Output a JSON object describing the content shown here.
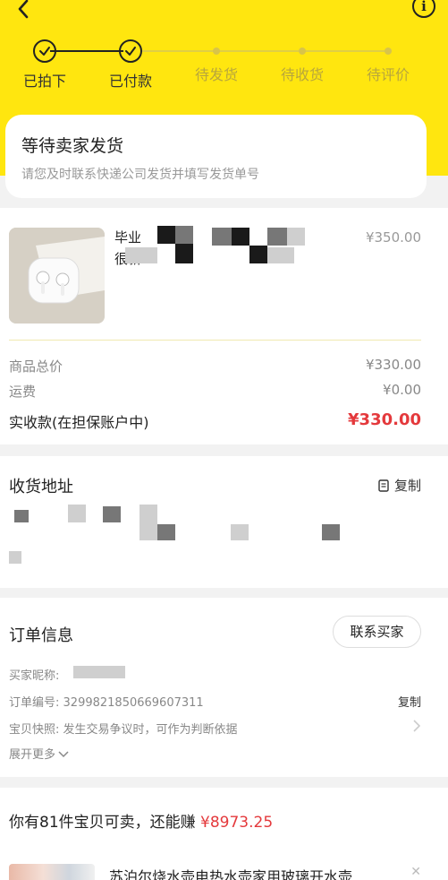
{
  "steps": [
    {
      "label": "已拍下",
      "done": true
    },
    {
      "label": "已付款",
      "done": true
    },
    {
      "label": "待发货",
      "done": false
    },
    {
      "label": "待收货",
      "done": false
    },
    {
      "label": "待评价",
      "done": false
    }
  ],
  "status": {
    "title": "等待卖家发货",
    "subtitle": "请您及时联系快递公司发货并填写发货单号"
  },
  "product": {
    "title_line1": "毕业",
    "title_line2": "很新",
    "price": "¥350.00"
  },
  "summary": {
    "goods_total_label": "商品总价",
    "goods_total_value": "¥330.00",
    "shipping_label": "运费",
    "shipping_value": "¥0.00",
    "received_label": "实收款(在担保账户中)",
    "received_value": "¥330.00"
  },
  "address": {
    "title": "收货地址",
    "copy_label": "复制"
  },
  "order": {
    "title": "订单信息",
    "contact_label": "联系买家",
    "buyer_label": "买家昵称:",
    "order_no_label": "订单编号:",
    "order_no": "3299821850669607311",
    "copy_label": "复制",
    "snapshot_label": "宝贝快照:",
    "snapshot_text": "发生交易争议时，可作为判断依据",
    "expand_label": "展开更多"
  },
  "earn": {
    "prefix": "你有81件宝贝可卖，还能赚 ",
    "amount": "¥8973.25",
    "item_title": "苏泊尔烧水壶电热水壶家用玻璃开水壶..."
  },
  "colors": {
    "header_yellow": "#ffe60f",
    "price_red": "#e4393c"
  },
  "icons": [
    "back-arrow-icon",
    "info-icon",
    "check-icon",
    "copy-icon",
    "chevron-down-icon",
    "chevron-right-icon",
    "close-icon"
  ]
}
